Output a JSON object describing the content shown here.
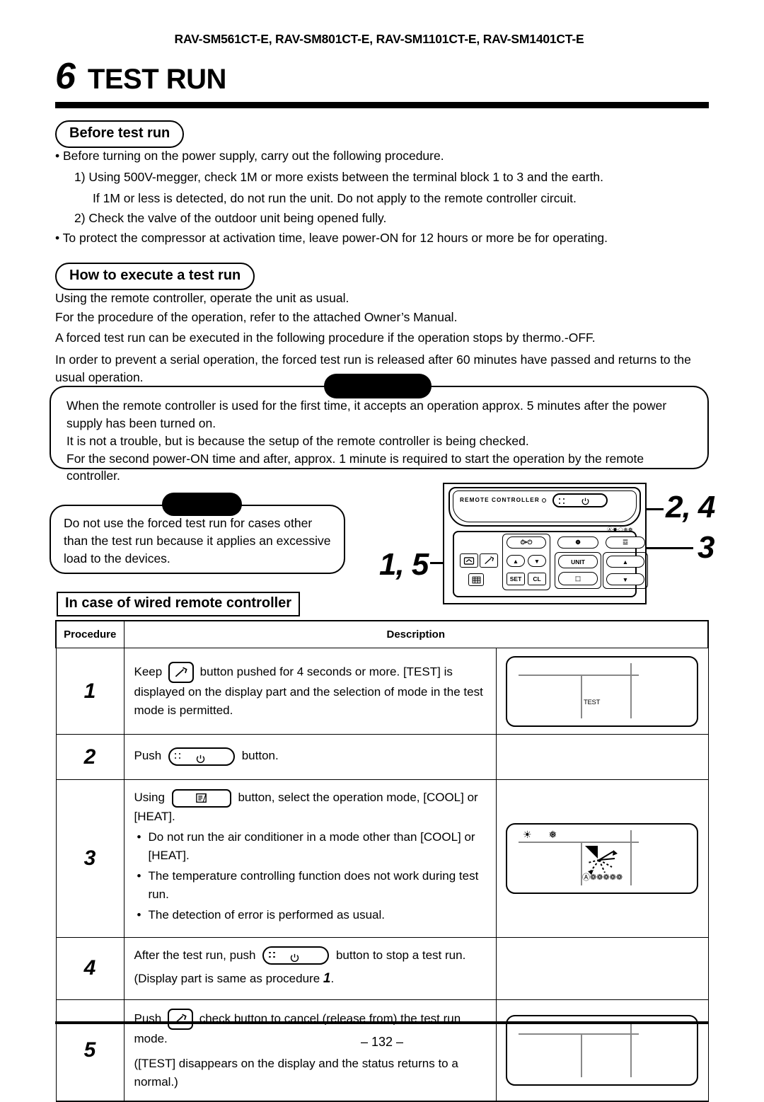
{
  "header": {
    "model_line": "RAV-SM561CT-E, RAV-SM801CT-E, RAV-SM1101CT-E, RAV-SM1401CT-E",
    "chapter_number": "6",
    "chapter_title": "TEST RUN"
  },
  "before_test_run": {
    "heading": "Before test run",
    "bullet1": "• Before turning on the power supply, carry out the following procedure.",
    "item1": "1)  Using 500V-megger, check 1M    or more exists between the terminal block 1 to 3 and the earth.",
    "item1b": "If 1M    or less is detected, do not run the unit.  Do not apply to the remote controller circuit.",
    "item2": "2)  Check the valve of the outdoor unit being opened fully.",
    "bullet2": "• To protect the compressor at activation time, leave power-ON for 12 hours or more be for operating."
  },
  "how_to": {
    "heading": "How to execute a test run",
    "line1": "Using the remote controller, operate the unit as usual.",
    "line2": "For the procedure of the operation, refer to the attached Owner’s Manual.",
    "line3": "A forced test run can be executed in the following procedure if the operation stops by thermo.-OFF.",
    "line4": "In order to prevent a serial operation, the forced test run is released after 60 minutes have passed and returns to the usual operation."
  },
  "note_box": {
    "line1": "When the remote controller is used for the first time, it accepts an operation approx. 5 minutes after the power supply has been turned on.",
    "line2": "It is not a trouble, but is because the setup of the remote controller is being checked.",
    "line3": "For the second power-ON time and after, approx. 1 minute is required to start the operation by the remote controller."
  },
  "caution_box": {
    "line1": "Do not use the forced test run for cases other than the test run because it applies an excessive load to the devices."
  },
  "callouts": {
    "left": "1, 5",
    "top_right": "2, 4",
    "bottom_right": "3"
  },
  "remote": {
    "label": "REMOTE CONTROLLER",
    "timer_btn": "⏱▸⏻",
    "fan_btn": "❁",
    "mode_btn": "☲",
    "unit_btn": "UNIT",
    "set_btn": "SET",
    "cl_btn": "CL",
    "up_btn": "▲",
    "down_btn": "▼",
    "vent_btn": "⌸",
    "louver_btn": "⌂",
    "check_btn": "ᴰ",
    "swing_btn": "⬚",
    "mode_icons": "Ⓐ☀◇❄❁"
  },
  "table": {
    "col_procedure": "Procedure",
    "col_description": "Description",
    "rows": [
      {
        "number": "1",
        "text_before": "Keep",
        "button": "wrench",
        "text_after": "button pushed for 4 seconds or more.  [TEST] is displayed on the display part and the selection of mode in the test mode is permitted.",
        "figure": "lcd-test"
      },
      {
        "number": "2",
        "text_before": "Push",
        "button": "onoff",
        "text_after": "button.",
        "figure": "none"
      },
      {
        "number": "3",
        "text_before": "Using",
        "button": "mode",
        "text_after": "button, select the operation mode, [COOL] or [HEAT].",
        "bullets": [
          "Do not run the air conditioner in a mode other than [COOL] or [HEAT].",
          "The temperature controlling function does not work during test run.",
          "The detection of error is performed as usual."
        ],
        "figure": "lcd-mode"
      },
      {
        "number": "4",
        "text_before": "After the test run, push",
        "button": "onoff",
        "text_after": "button to stop a test run.",
        "text_line2_a": "(Display part is same as procedure",
        "text_line2_num": "1",
        "text_line2_b": ".",
        "figure": "none"
      },
      {
        "number": "5",
        "text_before": "Push",
        "button": "wrench",
        "text_after": "check button to cancel (release from) the test run mode.",
        "text_line2": "([TEST] disappears on the display and the status returns to a normal.)",
        "figure": "lcd-blank"
      }
    ]
  },
  "lcd": {
    "test_label": "TEST",
    "mode_icons": "☀  ❅",
    "fan_icons": "Ⓐ❁❁❁❁❁"
  },
  "footer": {
    "page_number": "– 132 –"
  },
  "in_case": {
    "heading": "In case of wired remote controller"
  }
}
